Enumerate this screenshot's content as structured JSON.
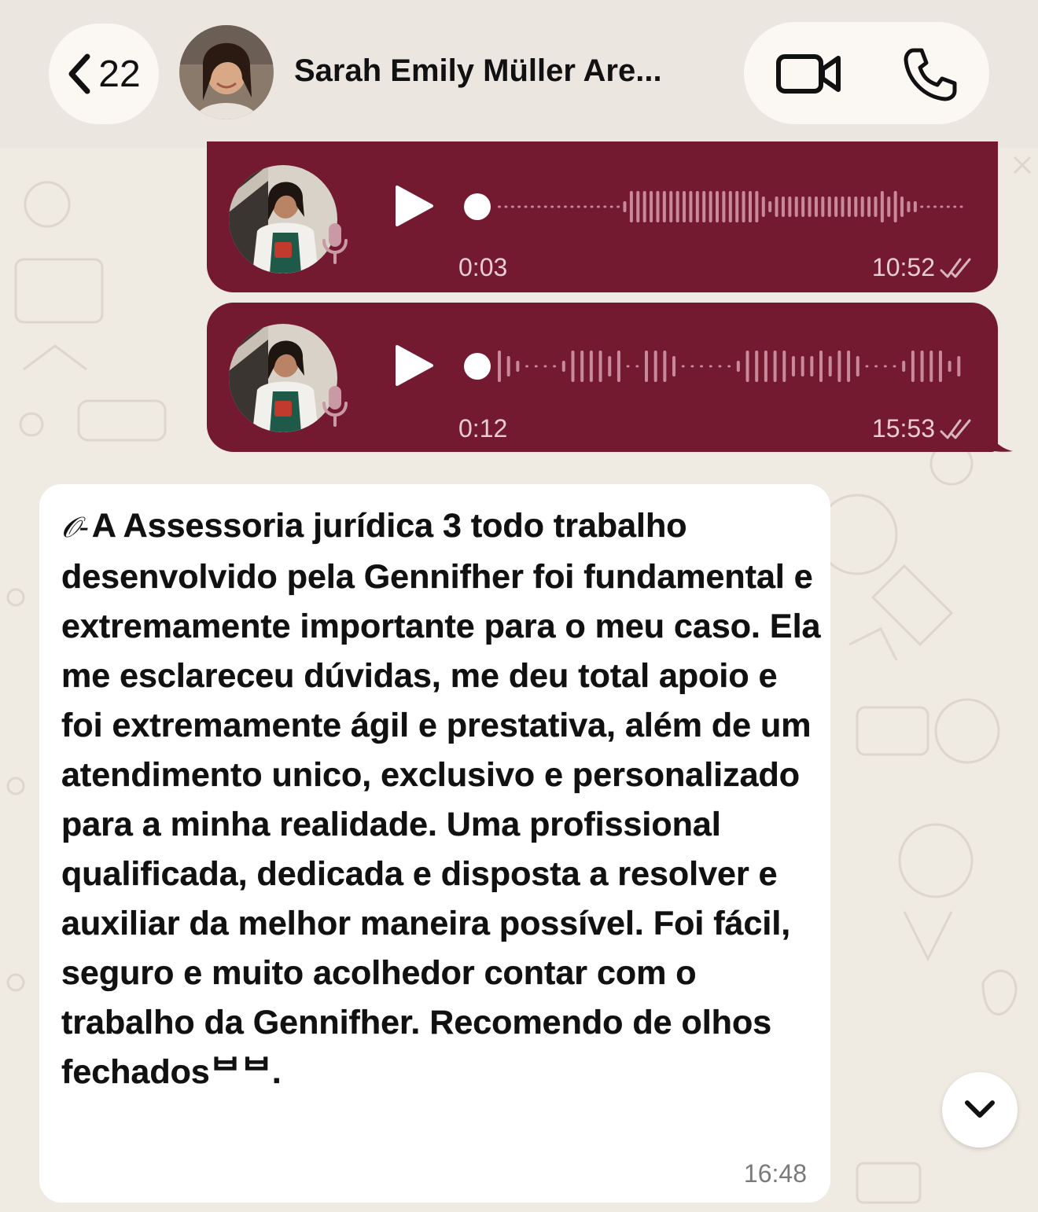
{
  "colors": {
    "chat_background": "#efeae2",
    "outgoing_bubble": "#731a31",
    "incoming_bubble": "#ffffff",
    "header_background": "#ece6e0"
  },
  "header": {
    "back_icon": "chevron-left-icon",
    "unread_count": "22",
    "contact_name": "Sarah Emily Müller Are...",
    "video_icon": "video-camera-icon",
    "call_icon": "phone-icon"
  },
  "voice_messages": [
    {
      "duration": "0:03",
      "time": "10:52",
      "status_icon": "double-check-icon",
      "progress": 0
    },
    {
      "duration": "0:12",
      "time": "15:53",
      "status_icon": "double-check-icon",
      "progress": 0
    }
  ],
  "text_message": {
    "lead_glyph": "𝒪-",
    "body": "A Assessoria jurídica 3 todo trabalho desenvolvido pela Gennifher foi fundamental e extremamente importante para o meu caso. Ela me esclareceu dúvidas, me deu total apoio e foi extremamente ágil e prestativa, além de um atendimento unico, exclusivo e personalizado para a minha realidade. Uma profissional qualificada, dedicada e disposta a resolver e auxiliar da melhor maneira possível. Foi fácil, seguro e muito acolhedor contar com o trabalho da Gennifher. Recomendo de olhos fechados",
    "trailing_glyph": "ᄇᄇ.",
    "time": "16:48"
  },
  "scroll_button_icon": "chevron-down-icon"
}
